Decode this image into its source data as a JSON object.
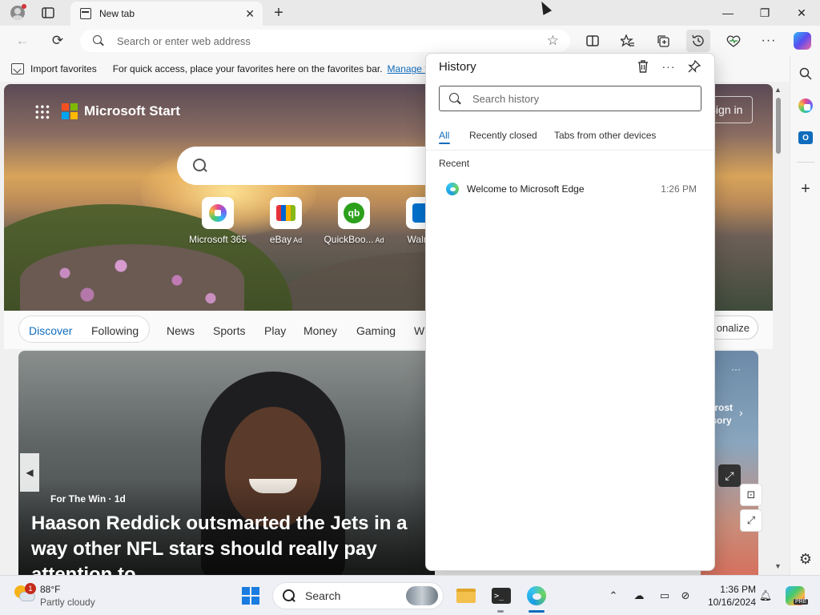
{
  "window": {
    "tab_title": "New tab",
    "tab_close": "✕",
    "new_tab": "+",
    "minimize": "—",
    "restore": "❐",
    "close": "✕"
  },
  "toolbar": {
    "back": "←",
    "refresh": "⟳",
    "address_placeholder": "Search or enter web address",
    "favorite_star": "☆"
  },
  "favorites_bar": {
    "import_label": "Import favorites",
    "message": "For quick access, place your favorites here on the favorites bar.",
    "manage_link": "Manage favorites now"
  },
  "new_tab_page": {
    "brand": "Microsoft Start",
    "sign_in": "Sign in",
    "quick_links": [
      {
        "label": "Microsoft 365",
        "ad": "",
        "icon": "microsoft-365-icon"
      },
      {
        "label": "eBay",
        "ad": "Ad",
        "icon": "ebay-icon"
      },
      {
        "label": "QuickBoo...",
        "ad": "Ad",
        "icon": "quickbooks-icon"
      },
      {
        "label": "Walma",
        "ad": "",
        "icon": "walmart-icon"
      }
    ],
    "feed_nav": {
      "discover": "Discover",
      "following": "Following",
      "items": [
        "News",
        "Sports",
        "Play",
        "Money",
        "Gaming",
        "W"
      ],
      "personalize": "onalize"
    },
    "news_card": {
      "source": "For The Win · 1d",
      "headline": "Haason Reddick outsmarted the Jets in a way other NFL stars should really pay attention to"
    },
    "weather_card": {
      "more": "···",
      "text_line1": "Frost",
      "text_line2": "isory"
    }
  },
  "history_panel": {
    "title": "History",
    "search_placeholder": "Search history",
    "tabs": [
      "All",
      "Recently closed",
      "Tabs from other devices"
    ],
    "active_tab": "All",
    "section_label": "Recent",
    "items": [
      {
        "title": "Welcome to Microsoft Edge",
        "time": "1:26 PM"
      }
    ]
  },
  "taskbar": {
    "weather_temp": "88°F",
    "weather_condition": "Partly cloudy",
    "weather_badge": "1",
    "search_label": "Search",
    "time": "1:36 PM",
    "date": "10/16/2024",
    "copilot_badge": "PRE"
  },
  "colors": {
    "accent": "#0f6cbd",
    "history_bg": "#ffffff",
    "taskbar_bg": "#eef0f5"
  }
}
